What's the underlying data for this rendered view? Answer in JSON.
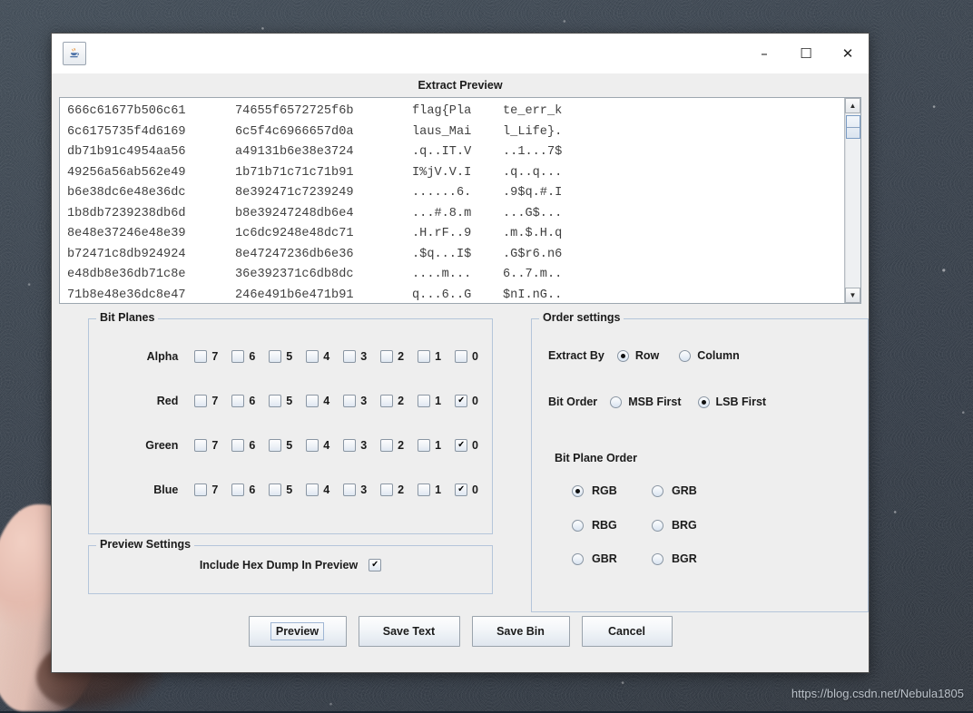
{
  "window": {
    "app_icon": "java-coffee-cup-icon",
    "dialog_title": "Extract Preview",
    "controls": {
      "minimize": "–",
      "maximize": "☐",
      "close": "✕"
    }
  },
  "preview": {
    "rows": [
      {
        "hex1": "666c61677b506c61",
        "hex2": "74655f6572725f6b",
        "ascii1": "flag{Pla",
        "ascii2": "te_err_k"
      },
      {
        "hex1": "6c6175735f4d6169",
        "hex2": "6c5f4c6966657d0a",
        "ascii1": "laus_Mai",
        "ascii2": "l_Life}."
      },
      {
        "hex1": "db71b91c4954aa56",
        "hex2": "a49131b6e38e3724",
        "ascii1": ".q..IT.V",
        "ascii2": "..1...7$"
      },
      {
        "hex1": "49256a56ab562e49",
        "hex2": "1b71b71c71c71b91",
        "ascii1": "I%jV.V.I",
        "ascii2": ".q..q..."
      },
      {
        "hex1": "b6e38dc6e48e36dc",
        "hex2": "8e392471c7239249",
        "ascii1": "......6.",
        "ascii2": ".9$q.#.I"
      },
      {
        "hex1": "1b8db7239238db6d",
        "hex2": "b8e39247248db6e4",
        "ascii1": "...#.8.m",
        "ascii2": "...G$..."
      },
      {
        "hex1": "8e48e37246e48e39",
        "hex2": "1c6dc9248e48dc71",
        "ascii1": ".H.rF..9",
        "ascii2": ".m.$.H.q"
      },
      {
        "hex1": "b72471c8db924924",
        "hex2": "8e47247236db6e36",
        "ascii1": ".$q...I$",
        "ascii2": ".G$r6.n6"
      },
      {
        "hex1": "e48db8e36db71c8e",
        "hex2": "36e392371c6db8dc",
        "ascii1": "....m...",
        "ascii2": "6..7.m.."
      },
      {
        "hex1": "71b8e48e36dc8e47",
        "hex2": "246e491b6e471b91",
        "ascii1": "q...6..G",
        "ascii2": "$nI.nG.."
      }
    ],
    "scrollbar": {
      "up": "▲",
      "down": "▼"
    }
  },
  "bit_planes": {
    "legend": "Bit Planes",
    "bits": [
      "7",
      "6",
      "5",
      "4",
      "3",
      "2",
      "1",
      "0"
    ],
    "channels": [
      {
        "label": "Alpha",
        "checked": [
          false,
          false,
          false,
          false,
          false,
          false,
          false,
          false
        ]
      },
      {
        "label": "Red",
        "checked": [
          false,
          false,
          false,
          false,
          false,
          false,
          false,
          true
        ]
      },
      {
        "label": "Green",
        "checked": [
          false,
          false,
          false,
          false,
          false,
          false,
          false,
          true
        ]
      },
      {
        "label": "Blue",
        "checked": [
          false,
          false,
          false,
          false,
          false,
          false,
          false,
          true
        ]
      }
    ]
  },
  "order_settings": {
    "legend": "Order settings",
    "extract_by": {
      "label": "Extract By",
      "options": [
        "Row",
        "Column"
      ],
      "selected": "Row"
    },
    "bit_order": {
      "label": "Bit Order",
      "options": [
        "MSB First",
        "LSB First"
      ],
      "selected": "LSB First"
    },
    "bit_plane_order": {
      "label": "Bit Plane Order",
      "options": [
        "RGB",
        "GRB",
        "RBG",
        "BRG",
        "GBR",
        "BGR"
      ],
      "selected": "RGB"
    }
  },
  "preview_settings": {
    "legend": "Preview Settings",
    "include_hex_dump": {
      "label": "Include Hex Dump In Preview",
      "checked": true
    }
  },
  "buttons": {
    "preview": "Preview",
    "save_text": "Save Text",
    "save_bin": "Save Bin",
    "cancel": "Cancel"
  },
  "watermark": "https://blog.csdn.net/Nebula1805"
}
